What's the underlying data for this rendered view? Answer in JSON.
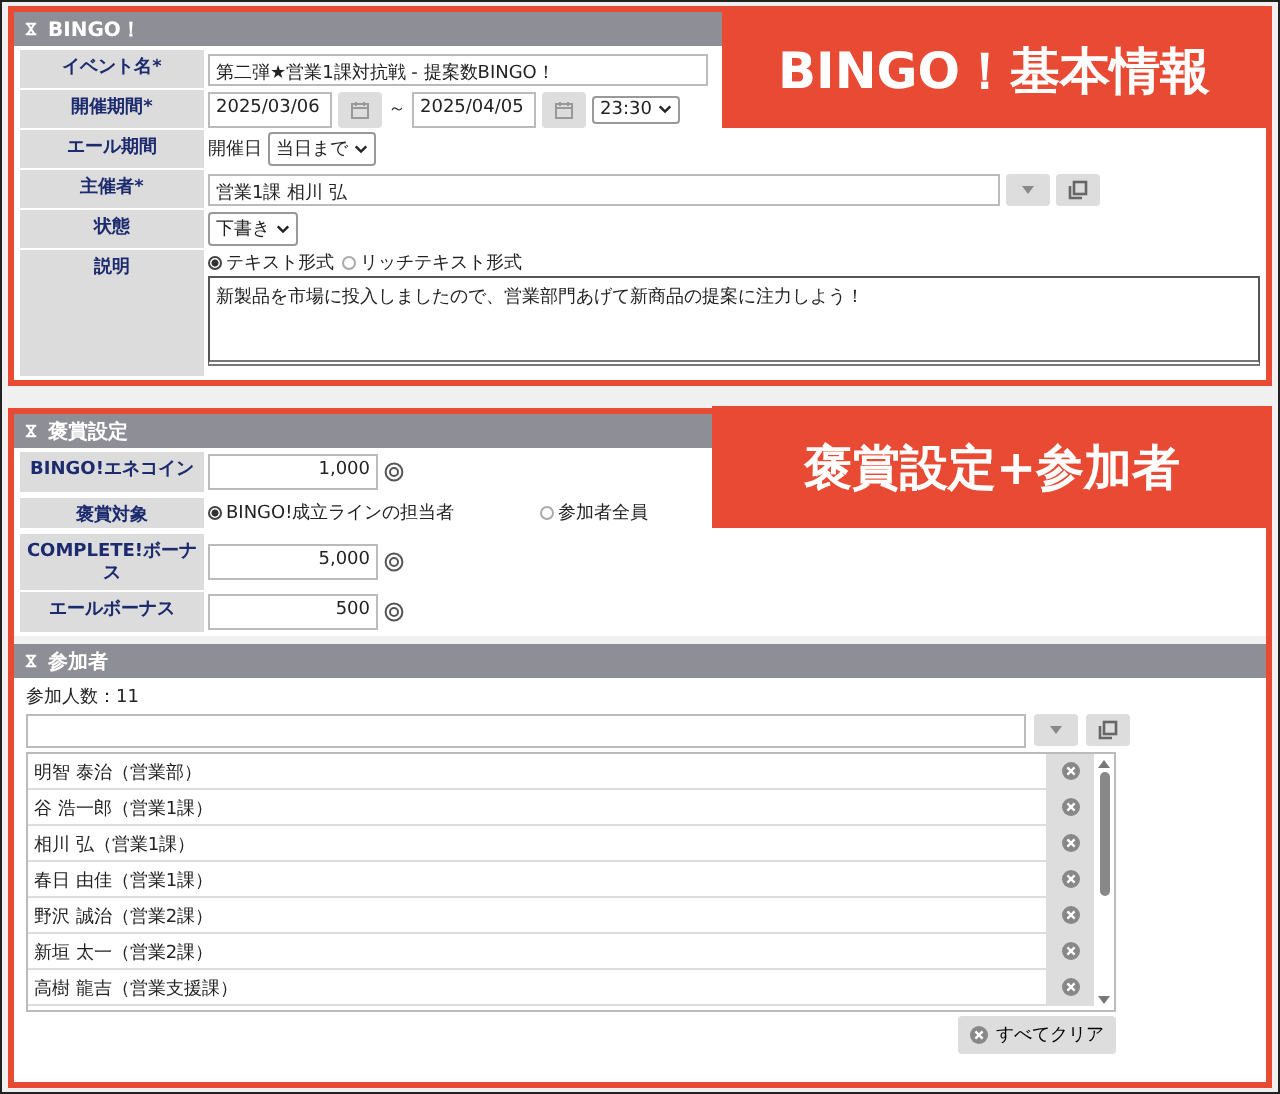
{
  "basic": {
    "title": "BINGO！",
    "callout": "BINGO！基本情報",
    "rows": [
      {
        "kind": "text",
        "label": "イベント名*",
        "value": "第二弾★営業1課対抗戦 - 提案数BINGO！"
      },
      {
        "kind": "period",
        "label": "開催期間*",
        "start": "2025/03/06",
        "separator": "～",
        "end": "2025/04/05",
        "time": "23:30"
      },
      {
        "kind": "select",
        "label": "エール期間",
        "prefix": "開催日",
        "value": "当日まで"
      },
      {
        "kind": "picker",
        "label": "主催者*",
        "value": "営業1課 相川 弘"
      },
      {
        "kind": "select",
        "label": "状態",
        "value": "下書き"
      },
      {
        "kind": "description",
        "label": "説明",
        "formats": [
          {
            "label": "テキスト形式",
            "selected": true
          },
          {
            "label": "リッチテキスト形式",
            "selected": false
          }
        ],
        "value": "新製品を市場に投入しましたので、営業部門あげて新商品の提案に注力しよう！"
      }
    ]
  },
  "reward": {
    "title": "褒賞設定",
    "callout": "褒賞設定+参加者",
    "rows": [
      {
        "kind": "amount",
        "label": "BINGO!エネコイン",
        "value": "1,000"
      },
      {
        "kind": "radio",
        "label": "褒賞対象",
        "options": [
          {
            "label": "BINGO!成立ラインの担当者",
            "selected": true
          },
          {
            "label": "参加者全員",
            "selected": false
          }
        ]
      },
      {
        "kind": "amount",
        "label": "COMPLETE!ボーナス",
        "value": "5,000"
      },
      {
        "kind": "amount",
        "label": "エールボーナス",
        "value": "500"
      }
    ]
  },
  "participants": {
    "title": "参加者",
    "count": "参加人数：11",
    "members": [
      "明智 泰治（営業部）",
      "谷 浩一郎（営業1課）",
      "相川 弘（営業1課）",
      "春日 由佳（営業1課）",
      "野沢 誠治（営業2課）",
      "新垣 太一（営業2課）",
      "高樹 龍吉（営業支援課）"
    ],
    "clear_button": "すべてクリア"
  }
}
